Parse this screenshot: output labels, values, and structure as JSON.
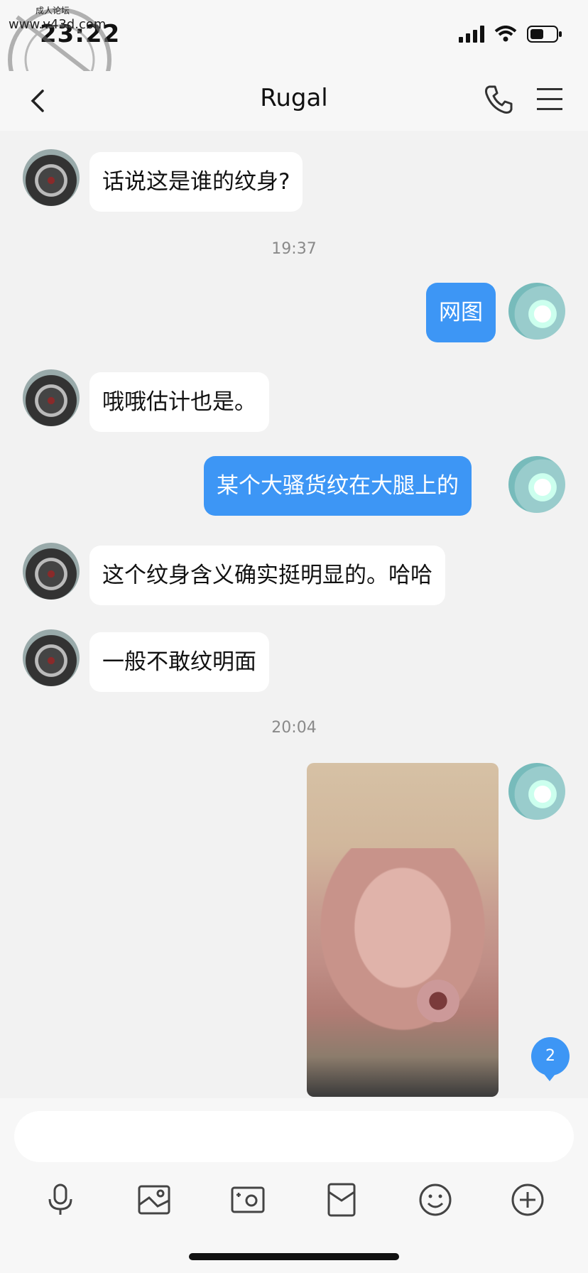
{
  "status_bar": {
    "time": "23:22",
    "watermark_line1": "成人论坛",
    "watermark_line2": "www.v43d.com"
  },
  "header": {
    "title": "Rugal"
  },
  "messages": [
    {
      "side": "in",
      "text": "话说这是谁的纹身?"
    },
    {
      "timestamp": "19:37"
    },
    {
      "side": "out",
      "text": "网图"
    },
    {
      "side": "in",
      "text": "哦哦估计也是。"
    },
    {
      "side": "out",
      "text": "某个大骚货纹在大腿上的"
    },
    {
      "side": "in",
      "text": "这个纹身含义确实挺明显的。哈哈"
    },
    {
      "side": "in",
      "text": "一般不敢纹明面"
    },
    {
      "timestamp": "20:04"
    }
  ],
  "unread_badge": "2",
  "icons": {
    "back": "chevron-left-icon",
    "phone": "phone-icon",
    "menu": "menu-icon",
    "tools": [
      "microphone-icon",
      "image-icon",
      "camera-icon",
      "red-packet-icon",
      "emoji-icon",
      "plus-icon"
    ]
  },
  "colors": {
    "accent": "#3d96f5",
    "background": "#f2f2f2",
    "incoming_bubble": "#ffffff"
  }
}
